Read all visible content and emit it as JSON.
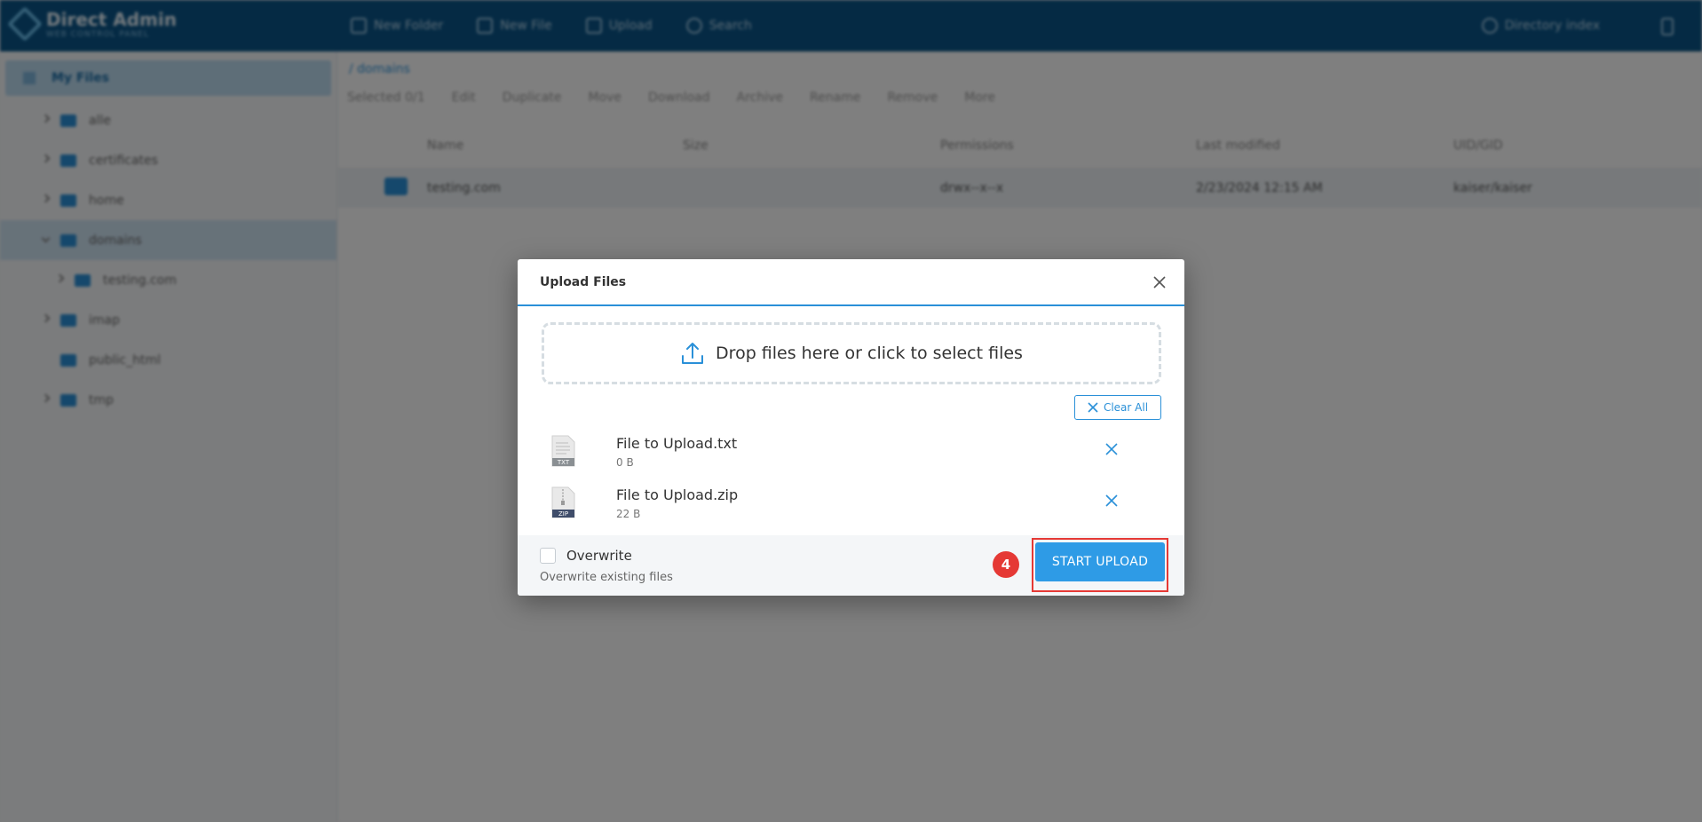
{
  "app": {
    "logo_title": "Direct Admin",
    "logo_sub": "WEB CONTROL PANEL",
    "topnav": [
      "New Folder",
      "New File",
      "Upload",
      "Search"
    ],
    "sync_label": "Directory index"
  },
  "sidebar": {
    "root_label": "My Files",
    "items": [
      {
        "label": "alle",
        "expandable": true,
        "active": false,
        "indent": 0
      },
      {
        "label": "certificates",
        "expandable": true,
        "active": false,
        "indent": 0
      },
      {
        "label": "home",
        "expandable": true,
        "active": false,
        "indent": 0
      },
      {
        "label": "domains",
        "expandable": true,
        "active": true,
        "indent": 0
      },
      {
        "label": "testing.com",
        "expandable": true,
        "active": false,
        "indent": 1
      },
      {
        "label": "imap",
        "expandable": true,
        "active": false,
        "indent": 0
      },
      {
        "label": "public_html",
        "expandable": false,
        "active": false,
        "indent": 0
      },
      {
        "label": "tmp",
        "expandable": true,
        "active": false,
        "indent": 0
      }
    ]
  },
  "main": {
    "breadcrumb": "/ domains",
    "toolbar": [
      "Selected 0/1",
      "Edit",
      "Duplicate",
      "Move",
      "Download",
      "Archive",
      "Rename",
      "Remove",
      "More"
    ],
    "columns": [
      "Name",
      "Size",
      "Permissions",
      "Last modified",
      "UID/GID"
    ],
    "row": {
      "name": "testing.com",
      "size": "",
      "permissions": "drwx--x--x",
      "modified": "2/23/2024 12:15 AM",
      "owner": "kaiser/kaiser"
    }
  },
  "modal": {
    "title": "Upload Files",
    "drop_text": "Drop files here or click to select files",
    "clear_all": "Clear All",
    "files": [
      {
        "name": "File to Upload.txt",
        "size": "0 B",
        "ext": "TXT"
      },
      {
        "name": "File to Upload.zip",
        "size": "22 B",
        "ext": "ZIP"
      }
    ],
    "overwrite_label": "Overwrite",
    "overwrite_desc": "Overwrite existing files",
    "overwrite_checked": false,
    "step_number": "4",
    "start_upload": "START UPLOAD"
  },
  "colors": {
    "accent": "#2a90d8",
    "button": "#2e9be6",
    "highlight": "#e53935",
    "topbar": "#0a5589"
  }
}
